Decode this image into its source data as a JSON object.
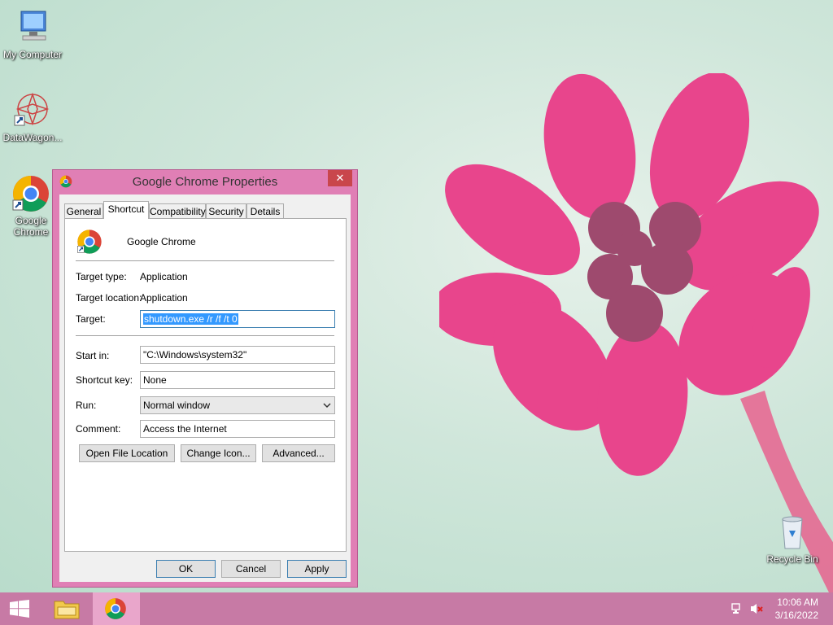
{
  "desktop": {
    "icons": [
      {
        "label": "My Computer"
      },
      {
        "label": "DataWagon..."
      },
      {
        "label": "Google Chrome"
      },
      {
        "label": "Recycle Bin"
      }
    ]
  },
  "dialog": {
    "title": "Google Chrome Properties",
    "close_label": "✕",
    "tabs": [
      "General",
      "Shortcut",
      "Compatibility",
      "Security",
      "Details"
    ],
    "active_tab": "Shortcut",
    "app_name": "Google Chrome",
    "fields": {
      "target_type_label": "Target type:",
      "target_type_value": "Application",
      "target_location_label": "Target location:",
      "target_location_value": "Application",
      "target_label": "Target:",
      "target_value": "shutdown.exe /r /f /t 0",
      "start_in_label": "Start in:",
      "start_in_value": "\"C:\\Windows\\system32\"",
      "shortcut_key_label": "Shortcut key:",
      "shortcut_key_value": "None",
      "run_label": "Run:",
      "run_value": "Normal window",
      "comment_label": "Comment:",
      "comment_value": "Access the Internet"
    },
    "buttons": {
      "open_file_location": "Open File Location",
      "change_icon": "Change Icon...",
      "advanced": "Advanced...",
      "ok": "OK",
      "cancel": "Cancel",
      "apply": "Apply"
    }
  },
  "taskbar": {
    "time": "10:06 AM",
    "date": "3/16/2022"
  },
  "colors": {
    "dialog_frame": "#e07fb5",
    "taskbar": "#c77aa5",
    "close_button": "#c9464c",
    "selection": "#3399ff"
  }
}
